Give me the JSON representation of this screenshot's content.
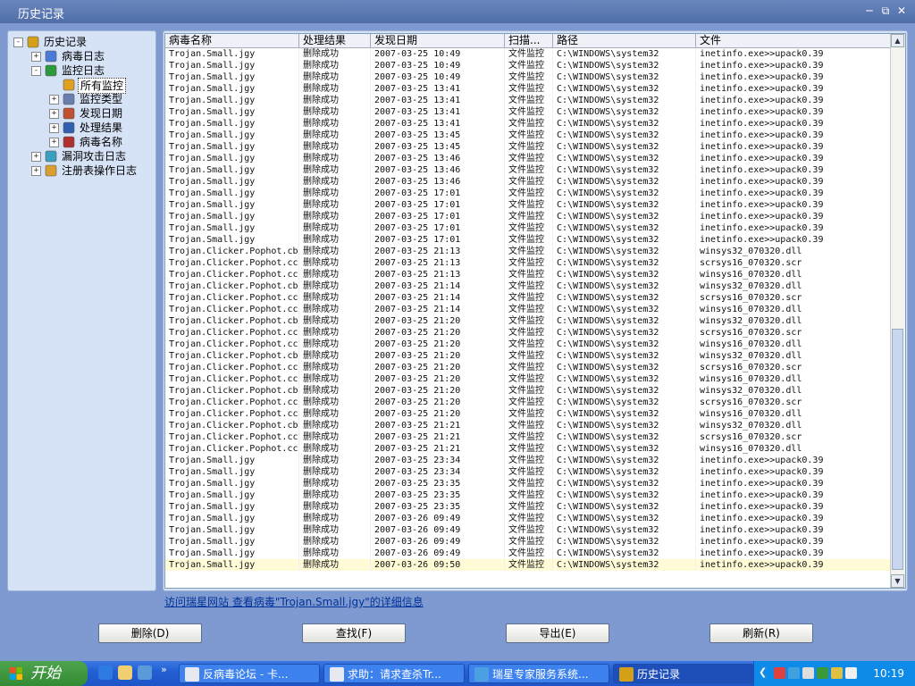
{
  "window": {
    "title": "历史记录"
  },
  "tree": [
    {
      "label": "历史记录",
      "expander": "-",
      "level": 0,
      "icon": "history-icon",
      "color": "#d4a017"
    },
    {
      "label": "病毒日志",
      "expander": "+",
      "level": 1,
      "icon": "virus-log-icon",
      "color": "#4a7bd6"
    },
    {
      "label": "监控日志",
      "expander": "-",
      "level": 1,
      "icon": "monitor-umbrella-icon",
      "color": "#2a9a3a"
    },
    {
      "label": "所有监控",
      "expander": "",
      "level": 2,
      "icon": "all-monitor-icon",
      "color": "#e0a020",
      "selected": true
    },
    {
      "label": "监控类型",
      "expander": "+",
      "level": 2,
      "icon": "magnifier-icon",
      "color": "#6a7fb0"
    },
    {
      "label": "发现日期",
      "expander": "+",
      "level": 2,
      "icon": "calendar-clock-icon",
      "color": "#c05030"
    },
    {
      "label": "处理结果",
      "expander": "+",
      "level": 2,
      "icon": "result-icon",
      "color": "#3060b0"
    },
    {
      "label": "病毒名称",
      "expander": "+",
      "level": 2,
      "icon": "virus-name-icon",
      "color": "#b03030"
    },
    {
      "label": "漏洞攻击日志",
      "expander": "+",
      "level": 1,
      "icon": "exploit-log-icon",
      "color": "#3aa0c0"
    },
    {
      "label": "注册表操作日志",
      "expander": "+",
      "level": 1,
      "icon": "registry-log-icon",
      "color": "#d9a030"
    }
  ],
  "grid": {
    "columns": [
      "病毒名称",
      "处理结果",
      "发现日期",
      "扫描...",
      "路径",
      "文件"
    ],
    "rows": [
      [
        "Trojan.Small.jgy",
        "删除成功",
        "2007-03-25 10:49",
        "文件监控",
        "C:\\WINDOWS\\system32",
        "inetinfo.exe>>upack0.39"
      ],
      [
        "Trojan.Small.jgy",
        "删除成功",
        "2007-03-25 10:49",
        "文件监控",
        "C:\\WINDOWS\\system32",
        "inetinfo.exe>>upack0.39"
      ],
      [
        "Trojan.Small.jgy",
        "删除成功",
        "2007-03-25 10:49",
        "文件监控",
        "C:\\WINDOWS\\system32",
        "inetinfo.exe>>upack0.39"
      ],
      [
        "Trojan.Small.jgy",
        "删除成功",
        "2007-03-25 13:41",
        "文件监控",
        "C:\\WINDOWS\\system32",
        "inetinfo.exe>>upack0.39"
      ],
      [
        "Trojan.Small.jgy",
        "删除成功",
        "2007-03-25 13:41",
        "文件监控",
        "C:\\WINDOWS\\system32",
        "inetinfo.exe>>upack0.39"
      ],
      [
        "Trojan.Small.jgy",
        "删除成功",
        "2007-03-25 13:41",
        "文件监控",
        "C:\\WINDOWS\\system32",
        "inetinfo.exe>>upack0.39"
      ],
      [
        "Trojan.Small.jgy",
        "删除成功",
        "2007-03-25 13:41",
        "文件监控",
        "C:\\WINDOWS\\system32",
        "inetinfo.exe>>upack0.39"
      ],
      [
        "Trojan.Small.jgy",
        "删除成功",
        "2007-03-25 13:45",
        "文件监控",
        "C:\\WINDOWS\\system32",
        "inetinfo.exe>>upack0.39"
      ],
      [
        "Trojan.Small.jgy",
        "删除成功",
        "2007-03-25 13:45",
        "文件监控",
        "C:\\WINDOWS\\system32",
        "inetinfo.exe>>upack0.39"
      ],
      [
        "Trojan.Small.jgy",
        "删除成功",
        "2007-03-25 13:46",
        "文件监控",
        "C:\\WINDOWS\\system32",
        "inetinfo.exe>>upack0.39"
      ],
      [
        "Trojan.Small.jgy",
        "删除成功",
        "2007-03-25 13:46",
        "文件监控",
        "C:\\WINDOWS\\system32",
        "inetinfo.exe>>upack0.39"
      ],
      [
        "Trojan.Small.jgy",
        "删除成功",
        "2007-03-25 13:46",
        "文件监控",
        "C:\\WINDOWS\\system32",
        "inetinfo.exe>>upack0.39"
      ],
      [
        "Trojan.Small.jgy",
        "删除成功",
        "2007-03-25 17:01",
        "文件监控",
        "C:\\WINDOWS\\system32",
        "inetinfo.exe>>upack0.39"
      ],
      [
        "Trojan.Small.jgy",
        "删除成功",
        "2007-03-25 17:01",
        "文件监控",
        "C:\\WINDOWS\\system32",
        "inetinfo.exe>>upack0.39"
      ],
      [
        "Trojan.Small.jgy",
        "删除成功",
        "2007-03-25 17:01",
        "文件监控",
        "C:\\WINDOWS\\system32",
        "inetinfo.exe>>upack0.39"
      ],
      [
        "Trojan.Small.jgy",
        "删除成功",
        "2007-03-25 17:01",
        "文件监控",
        "C:\\WINDOWS\\system32",
        "inetinfo.exe>>upack0.39"
      ],
      [
        "Trojan.Small.jgy",
        "删除成功",
        "2007-03-25 17:01",
        "文件监控",
        "C:\\WINDOWS\\system32",
        "inetinfo.exe>>upack0.39"
      ],
      [
        "Trojan.Clicker.Pophot.cb",
        "删除成功",
        "2007-03-25 21:13",
        "文件监控",
        "C:\\WINDOWS\\system32",
        "winsys32_070320.dll"
      ],
      [
        "Trojan.Clicker.Pophot.cc",
        "删除成功",
        "2007-03-25 21:13",
        "文件监控",
        "C:\\WINDOWS\\system32",
        "scrsys16_070320.scr"
      ],
      [
        "Trojan.Clicker.Pophot.cc",
        "删除成功",
        "2007-03-25 21:13",
        "文件监控",
        "C:\\WINDOWS\\system32",
        "winsys16_070320.dll"
      ],
      [
        "Trojan.Clicker.Pophot.cb",
        "删除成功",
        "2007-03-25 21:14",
        "文件监控",
        "C:\\WINDOWS\\system32",
        "winsys32_070320.dll"
      ],
      [
        "Trojan.Clicker.Pophot.cc",
        "删除成功",
        "2007-03-25 21:14",
        "文件监控",
        "C:\\WINDOWS\\system32",
        "scrsys16_070320.scr"
      ],
      [
        "Trojan.Clicker.Pophot.cc",
        "删除成功",
        "2007-03-25 21:14",
        "文件监控",
        "C:\\WINDOWS\\system32",
        "winsys16_070320.dll"
      ],
      [
        "Trojan.Clicker.Pophot.cb",
        "删除成功",
        "2007-03-25 21:20",
        "文件监控",
        "C:\\WINDOWS\\system32",
        "winsys32_070320.dll"
      ],
      [
        "Trojan.Clicker.Pophot.cc",
        "删除成功",
        "2007-03-25 21:20",
        "文件监控",
        "C:\\WINDOWS\\system32",
        "scrsys16_070320.scr"
      ],
      [
        "Trojan.Clicker.Pophot.cc",
        "删除成功",
        "2007-03-25 21:20",
        "文件监控",
        "C:\\WINDOWS\\system32",
        "winsys16_070320.dll"
      ],
      [
        "Trojan.Clicker.Pophot.cb",
        "删除成功",
        "2007-03-25 21:20",
        "文件监控",
        "C:\\WINDOWS\\system32",
        "winsys32_070320.dll"
      ],
      [
        "Trojan.Clicker.Pophot.cc",
        "删除成功",
        "2007-03-25 21:20",
        "文件监控",
        "C:\\WINDOWS\\system32",
        "scrsys16_070320.scr"
      ],
      [
        "Trojan.Clicker.Pophot.cc",
        "删除成功",
        "2007-03-25 21:20",
        "文件监控",
        "C:\\WINDOWS\\system32",
        "winsys16_070320.dll"
      ],
      [
        "Trojan.Clicker.Pophot.cb",
        "删除成功",
        "2007-03-25 21:20",
        "文件监控",
        "C:\\WINDOWS\\system32",
        "winsys32_070320.dll"
      ],
      [
        "Trojan.Clicker.Pophot.cc",
        "删除成功",
        "2007-03-25 21:20",
        "文件监控",
        "C:\\WINDOWS\\system32",
        "scrsys16_070320.scr"
      ],
      [
        "Trojan.Clicker.Pophot.cc",
        "删除成功",
        "2007-03-25 21:20",
        "文件监控",
        "C:\\WINDOWS\\system32",
        "winsys16_070320.dll"
      ],
      [
        "Trojan.Clicker.Pophot.cb",
        "删除成功",
        "2007-03-25 21:21",
        "文件监控",
        "C:\\WINDOWS\\system32",
        "winsys32_070320.dll"
      ],
      [
        "Trojan.Clicker.Pophot.cc",
        "删除成功",
        "2007-03-25 21:21",
        "文件监控",
        "C:\\WINDOWS\\system32",
        "scrsys16_070320.scr"
      ],
      [
        "Trojan.Clicker.Pophot.cc",
        "删除成功",
        "2007-03-25 21:21",
        "文件监控",
        "C:\\WINDOWS\\system32",
        "winsys16_070320.dll"
      ],
      [
        "Trojan.Small.jgy",
        "删除成功",
        "2007-03-25 23:34",
        "文件监控",
        "C:\\WINDOWS\\system32",
        "inetinfo.exe>>upack0.39"
      ],
      [
        "Trojan.Small.jgy",
        "删除成功",
        "2007-03-25 23:34",
        "文件监控",
        "C:\\WINDOWS\\system32",
        "inetinfo.exe>>upack0.39"
      ],
      [
        "Trojan.Small.jgy",
        "删除成功",
        "2007-03-25 23:35",
        "文件监控",
        "C:\\WINDOWS\\system32",
        "inetinfo.exe>>upack0.39"
      ],
      [
        "Trojan.Small.jgy",
        "删除成功",
        "2007-03-25 23:35",
        "文件监控",
        "C:\\WINDOWS\\system32",
        "inetinfo.exe>>upack0.39"
      ],
      [
        "Trojan.Small.jgy",
        "删除成功",
        "2007-03-25 23:35",
        "文件监控",
        "C:\\WINDOWS\\system32",
        "inetinfo.exe>>upack0.39"
      ],
      [
        "Trojan.Small.jgy",
        "删除成功",
        "2007-03-26 09:49",
        "文件监控",
        "C:\\WINDOWS\\system32",
        "inetinfo.exe>>upack0.39"
      ],
      [
        "Trojan.Small.jgy",
        "删除成功",
        "2007-03-26 09:49",
        "文件监控",
        "C:\\WINDOWS\\system32",
        "inetinfo.exe>>upack0.39"
      ],
      [
        "Trojan.Small.jgy",
        "删除成功",
        "2007-03-26 09:49",
        "文件监控",
        "C:\\WINDOWS\\system32",
        "inetinfo.exe>>upack0.39"
      ],
      [
        "Trojan.Small.jgy",
        "删除成功",
        "2007-03-26 09:49",
        "文件监控",
        "C:\\WINDOWS\\system32",
        "inetinfo.exe>>upack0.39"
      ],
      [
        "Trojan.Small.jgy",
        "删除成功",
        "2007-03-26 09:50",
        "文件监控",
        "C:\\WINDOWS\\system32",
        "inetinfo.exe>>upack0.39"
      ]
    ]
  },
  "info_link": "访问瑞星网站 查看病毒\"Trojan.Small.jgy\"的详细信息",
  "buttons": {
    "delete": "删除(D)",
    "find": "查找(F)",
    "export": "导出(E)",
    "refresh": "刷新(R)"
  },
  "taskbar": {
    "start": "开始",
    "items": [
      {
        "label": "反病毒论坛 - 卡...",
        "color": "#e8e8f0"
      },
      {
        "label": "求助：请求查杀Tr...",
        "color": "#e8e8f0"
      },
      {
        "label": "瑞星专家服务系统...",
        "color": "#4aa0e0"
      },
      {
        "label": "历史记录",
        "color": "#d4a017"
      }
    ],
    "clock": "10:19",
    "chevron": "»",
    "tray_chevron": "❮"
  },
  "colors": {
    "accent": "#235fd4",
    "selected_row": "#fffbd6",
    "link": "#003399"
  }
}
